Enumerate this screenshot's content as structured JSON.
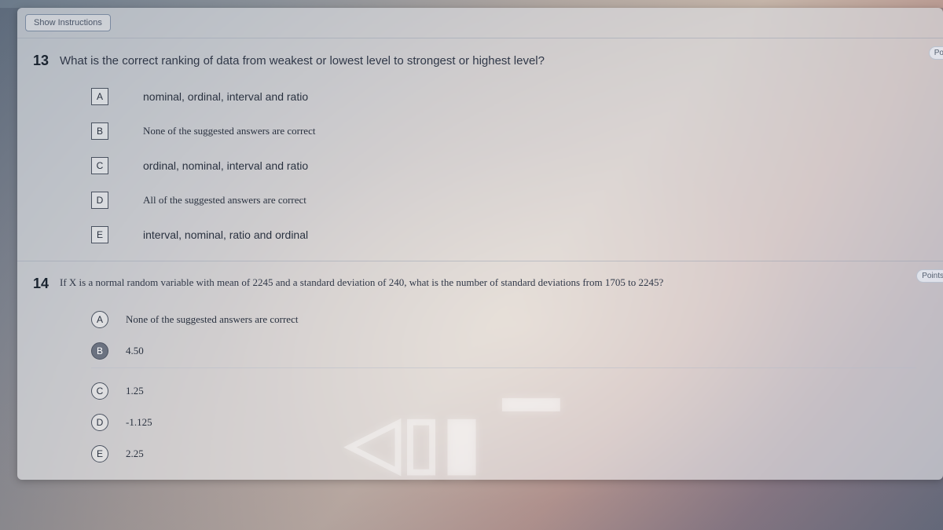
{
  "topbar": {
    "show_instructions": "Show Instructions"
  },
  "points_label_short": "Po",
  "points_label": "Points",
  "q13": {
    "number": "13",
    "prompt": "What is the correct ranking of data from weakest or lowest level to strongest or highest level?",
    "options": [
      {
        "letter": "A",
        "text": "nominal, ordinal, interval and ratio"
      },
      {
        "letter": "B",
        "text": "None of the suggested answers are correct"
      },
      {
        "letter": "C",
        "text": "ordinal, nominal, interval and ratio"
      },
      {
        "letter": "D",
        "text": "All of the suggested answers are correct"
      },
      {
        "letter": "E",
        "text": "interval, nominal, ratio and ordinal"
      }
    ]
  },
  "q14": {
    "number": "14",
    "prompt": "If X is a normal random variable with mean of 2245 and a standard deviation of 240, what is the number of standard deviations from 1705 to 2245?",
    "options": [
      {
        "letter": "A",
        "text": "None of the suggested answers are correct"
      },
      {
        "letter": "B",
        "text": "4.50",
        "selected": true
      },
      {
        "letter": "C",
        "text": "1.25"
      },
      {
        "letter": "D",
        "text": "-1.125"
      },
      {
        "letter": "E",
        "text": "2.25"
      }
    ]
  }
}
